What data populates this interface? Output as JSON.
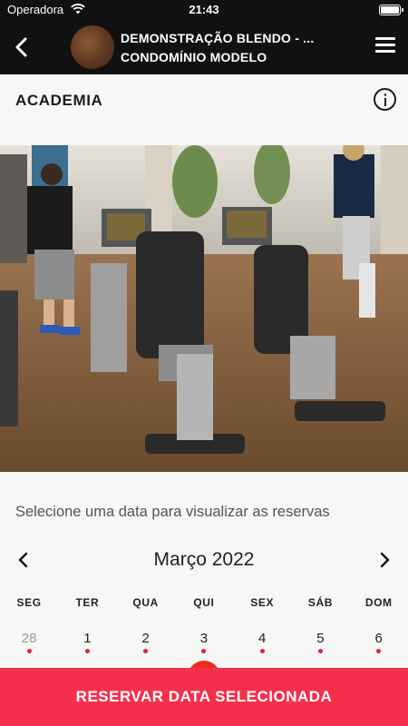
{
  "status_bar": {
    "carrier": "Operadora",
    "time": "21:43"
  },
  "header": {
    "title": "DEMONSTRAÇÃO BLENDO - ...",
    "subtitle": "CONDOMÍNIO MODELO"
  },
  "section": {
    "title": "ACADEMIA"
  },
  "calendar": {
    "prompt": "Selecione uma data para visualizar as reservas",
    "month_label": "Março 2022",
    "weekdays": [
      "SEG",
      "TER",
      "QUA",
      "QUI",
      "SEX",
      "SÁB",
      "DOM"
    ],
    "days": [
      {
        "label": "28",
        "muted": true
      },
      {
        "label": "1",
        "muted": false
      },
      {
        "label": "2",
        "muted": false
      },
      {
        "label": "3",
        "muted": false
      },
      {
        "label": "4",
        "muted": false
      },
      {
        "label": "5",
        "muted": false
      },
      {
        "label": "6",
        "muted": false
      }
    ]
  },
  "actions": {
    "reserve_label": "RESERVAR DATA SELECIONADA"
  },
  "colors": {
    "header_bg": "#111111",
    "accent": "#f5304c",
    "dot": "#e02131"
  }
}
